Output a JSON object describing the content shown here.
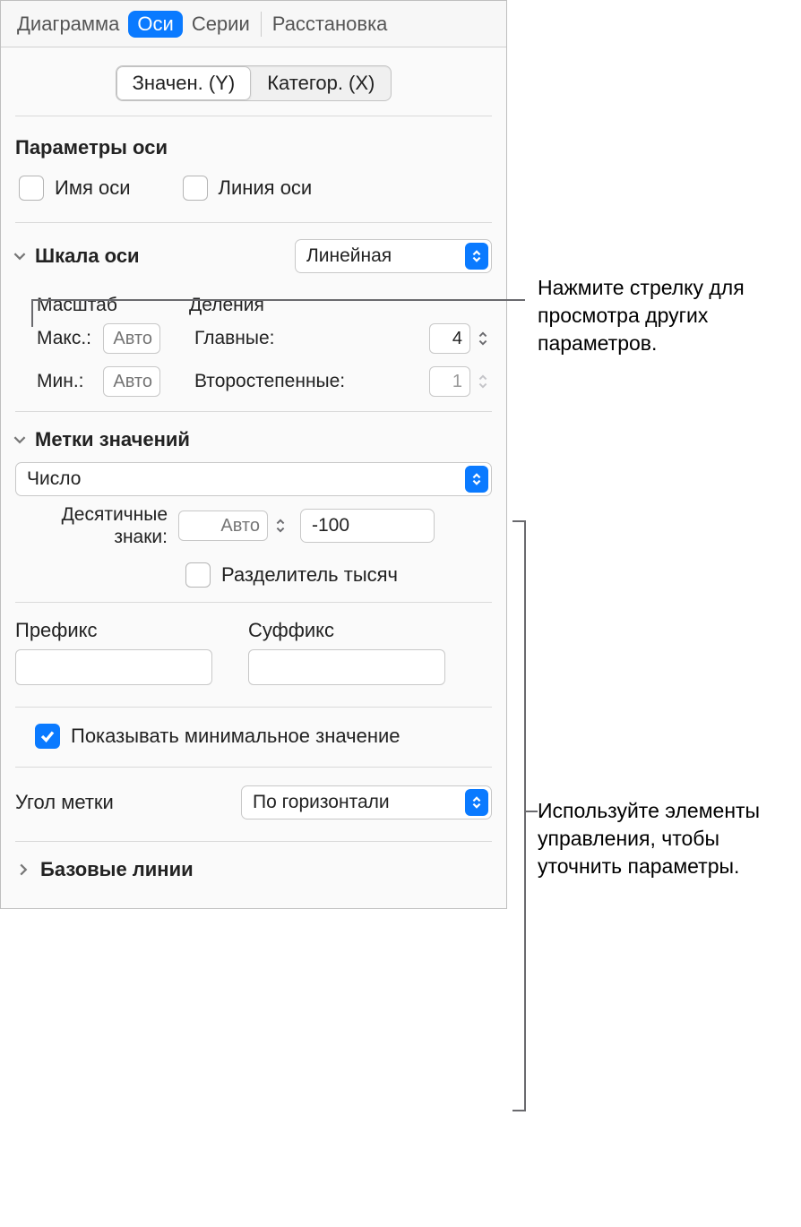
{
  "tabs": {
    "chart": "Диаграмма",
    "axes": "Оси",
    "series": "Серии",
    "arrange": "Расстановка"
  },
  "axis_segment": {
    "value_y": "Значен. (Y)",
    "category_x": "Категор. (X)"
  },
  "axis_options": {
    "title": "Параметры оси",
    "axis_name": "Имя оси",
    "axis_line": "Линия оси"
  },
  "scale": {
    "title": "Шкала оси",
    "type": "Линейная",
    "scale_header": "Масштаб",
    "divisions_header": "Деления",
    "max_label": "Макс.:",
    "min_label": "Мин.:",
    "auto": "Авто",
    "major_label": "Главные:",
    "minor_label": "Второстепенные:",
    "major_value": "4",
    "minor_value": "1"
  },
  "value_labels": {
    "title": "Метки значений",
    "format": "Число",
    "decimals_label": "Десятичные знаки:",
    "decimals_value": "Авто",
    "neg_format": "-100",
    "thousands_sep": "Разделитель тысяч",
    "prefix": "Префикс",
    "suffix": "Суффикс",
    "show_min": "Показывать минимальное значение",
    "angle_label": "Угол метки",
    "angle_value": "По горизонтали"
  },
  "baselines": "Базовые линии",
  "callouts": {
    "top": "Нажмите стрелку для просмотра других параметров.",
    "bottom": "Используйте элементы управления, чтобы уточнить параметры."
  }
}
